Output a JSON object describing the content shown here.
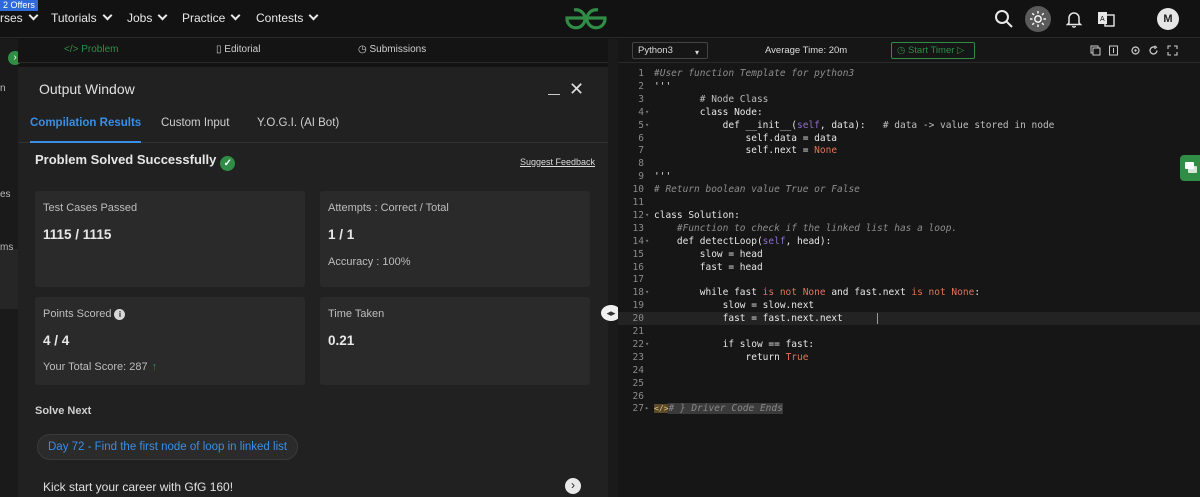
{
  "topnav": {
    "offers": "2 Offers",
    "items": [
      {
        "label": "rses",
        "has_caret": true
      },
      {
        "label": "Tutorials",
        "has_caret": true
      },
      {
        "label": "Jobs",
        "has_caret": true
      },
      {
        "label": "Practice",
        "has_caret": true
      },
      {
        "label": "Contests",
        "has_caret": true
      }
    ],
    "avatar_initial": "M",
    "icons": [
      "search-icon",
      "theme-sun-icon",
      "bell-icon",
      "translate-icon"
    ],
    "brand_color": "#2f8d46"
  },
  "sidebar": {
    "labels": [
      "n",
      "es",
      "ms"
    ]
  },
  "problem_tabs": {
    "problem": "Problem",
    "editorial": "Editorial",
    "submissions": "Submissions"
  },
  "output": {
    "title": "Output Window",
    "tabs": [
      "Compilation Results",
      "Custom Input",
      "Y.O.G.I. (AI Bot)"
    ],
    "active_tab": "Compilation Results",
    "status": "Problem Solved Successfully",
    "feedback": "Suggest Feedback",
    "test_cases": {
      "label": "Test Cases Passed",
      "value": "1115 / 1115"
    },
    "attempts": {
      "label": "Attempts : Correct / Total",
      "value": "1 / 1",
      "accuracy": "Accuracy : 100%"
    },
    "points": {
      "label": "Points Scored",
      "value": "4 / 4",
      "total_score": "Your Total Score:  287"
    },
    "time": {
      "label": "Time Taken",
      "value": "0.21"
    },
    "solve_next": "Solve Next",
    "next_problem": "Day 72 - Find the first node of loop in linked list",
    "kickstart": "Kick start your career with GfG 160!"
  },
  "editor": {
    "language": "Python3",
    "average_time": "Average Time: 20m",
    "start_timer": "Start Timer",
    "active_line": 20,
    "lines": [
      "#User function Template for python3",
      "'''",
      "        # Node Class",
      "        class Node:",
      "            def __init__(self, data):   # data -> value stored in node",
      "                self.data = data",
      "                self.next = None",
      "",
      "'''",
      "# Return boolean value True or False",
      "",
      "class Solution:",
      "    #Function to check if the linked list has a loop.",
      "    def detectLoop(self, head):",
      "        slow = head",
      "        fast = head",
      "",
      "        while fast is not None and fast.next is not None:",
      "            slow = slow.next",
      "            fast = fast.next.next",
      "",
      "            if slow == fast:",
      "                return True",
      "",
      "",
      "",
      "# } Driver Code Ends"
    ]
  }
}
